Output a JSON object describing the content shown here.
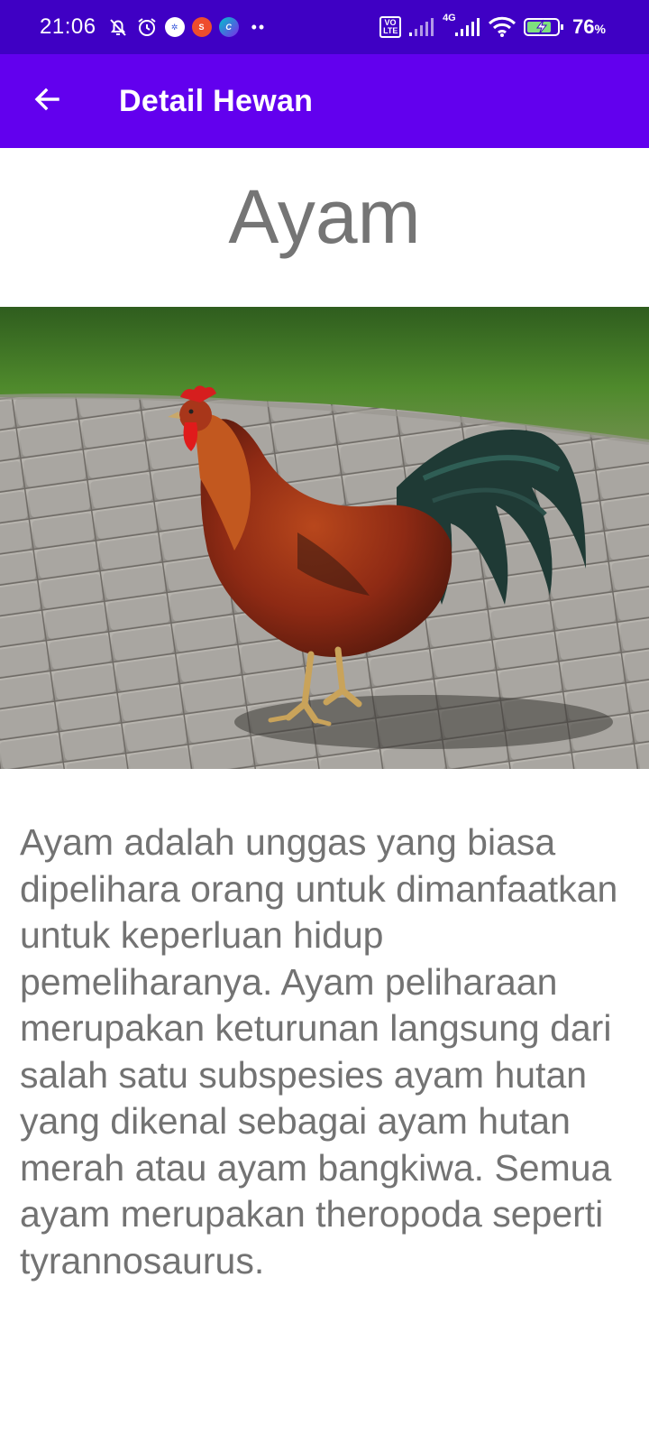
{
  "status_bar": {
    "time": "21:06",
    "battery_percent": "76",
    "battery_unit": "%",
    "network": "4G",
    "volte_label": "Vo\nLTE",
    "icons": [
      "mute-bell-icon",
      "alarm-icon",
      "app-notification-icon",
      "shopee-icon",
      "canva-icon",
      "more-dots-icon",
      "volte-icon",
      "signal-icon",
      "signal-4g-icon",
      "wifi-icon",
      "battery-charging-icon"
    ]
  },
  "app_bar": {
    "title": "Detail Hewan",
    "back_icon": "arrow-back-icon",
    "background": "#6200ee",
    "status_background": "#3f00c4"
  },
  "animal": {
    "name": "Ayam",
    "image_alt": "rooster-photo",
    "description": "Ayam adalah unggas yang biasa dipelihara orang untuk dimanfaatkan untuk keperluan hidup pemeliharanya. Ayam peliharaan merupakan keturunan langsung dari salah satu subspesies ayam hutan yang dikenal sebagai ayam hutan merah atau ayam bangkiwa. Semua ayam merupakan theropoda seperti tyrannosaurus."
  }
}
